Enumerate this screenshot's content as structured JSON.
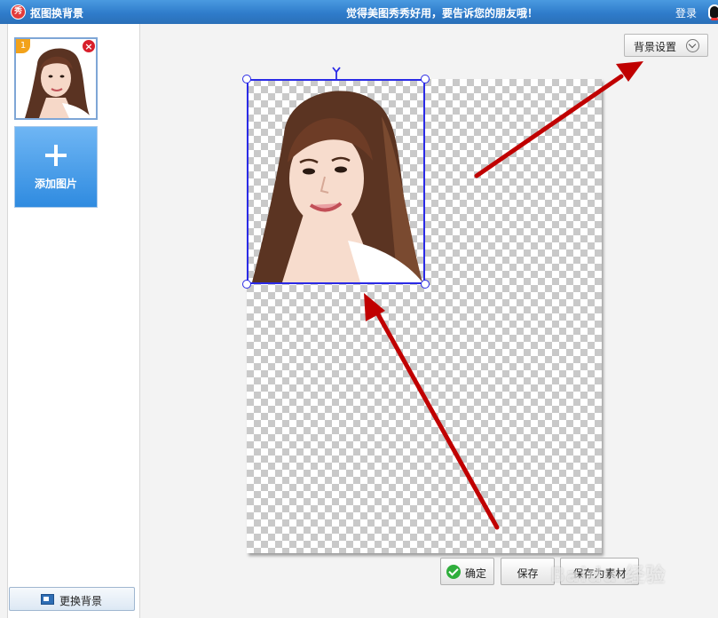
{
  "titlebar": {
    "app_title": "抠图换背景",
    "slogan": "觉得美图秀秀好用，要告诉您的朋友哦！",
    "login": "登录",
    "logo_glyph": "秀",
    "bar_color": "#2f7ccb"
  },
  "sidebar": {
    "thumbnail": {
      "index": "1",
      "delete_glyph": "×"
    },
    "add_image_label": "添加图片",
    "change_background_label": "更换背景"
  },
  "canvas": {
    "background_settings_label": "背景设置",
    "selection_color": "#2a2ae6"
  },
  "actions": {
    "confirm_label": "确定",
    "save_label": "保存",
    "save_as_material_label": "保存为素材"
  },
  "annotations": {
    "arrow_color": "#c00000",
    "watermark_text": "Baidu 经验"
  }
}
